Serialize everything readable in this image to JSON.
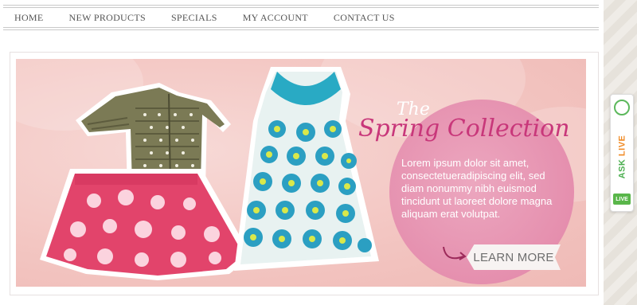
{
  "nav": {
    "items": [
      {
        "label": "HOME"
      },
      {
        "label": "NEW PRODUCTS"
      },
      {
        "label": "SPECIALS"
      },
      {
        "label": "MY ACCOUNT"
      },
      {
        "label": "CONTACT US"
      }
    ]
  },
  "banner": {
    "title_small": "The",
    "title_main": "Spring Collection",
    "body": "Lorem ipsum dolor sit amet, consectetueradipiscing elit, sed diam nonummy nibh euismod tincidunt ut laoreet dolore magna aliquam erat volutpat.",
    "cta_label": "LEARN MORE"
  },
  "side_widget": {
    "ask_word": "ASK ",
    "live_word": "LIVE",
    "badge": "LIVE",
    "icon": "headset-icon"
  },
  "colors": {
    "banner_bg": "#f3c6c2",
    "circle": "#e58fae",
    "title": "#c8377a",
    "accent_green": "#59b64a"
  }
}
